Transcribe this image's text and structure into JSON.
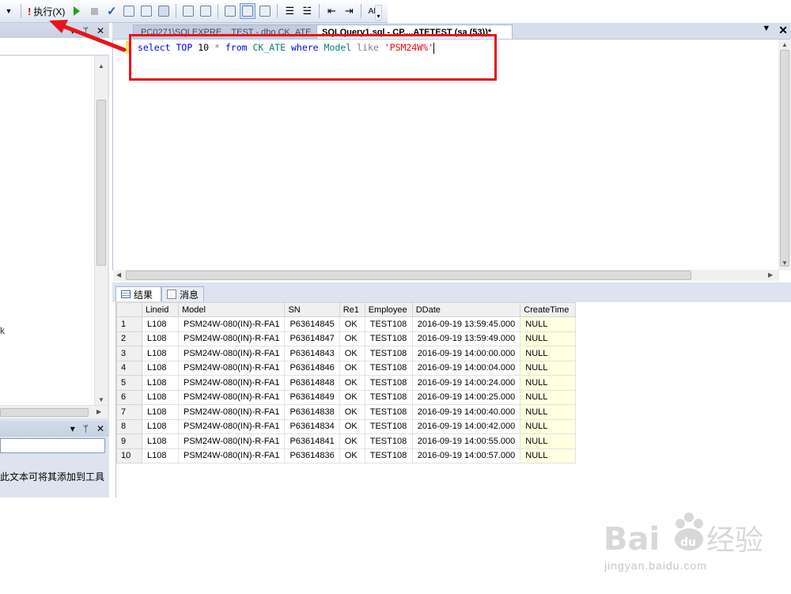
{
  "toolbar": {
    "execute_label": "执行(X)",
    "icons": [
      "dropdown-arrow-icon",
      "execute-icon",
      "debug-play-icon",
      "stop-icon",
      "parse-check-icon",
      "query-designer-icon",
      "plan-icon",
      "results-to-grid-icon",
      "results-to-text-icon",
      "results-to-file-icon",
      "comment-icon",
      "uncomment-icon",
      "decrease-indent-icon",
      "increase-indent-icon",
      "specify-values-icon"
    ]
  },
  "left_panel": {
    "header_pin": "ᛘ",
    "header_close": "✕",
    "tree_partial_text": "k",
    "toolbox_text": "此文本可将其添加到工具"
  },
  "editor_tabs": [
    {
      "label": ".PC0271\\SQLEXPRE....TEST - dbo.CK_ATE",
      "active": false
    },
    {
      "label": "SQLQuery1.sql - CP....ATETEST (sa (53))*",
      "active": true
    }
  ],
  "editor": {
    "tokens": [
      {
        "t": "select",
        "c": "kw"
      },
      {
        "t": " ",
        "c": ""
      },
      {
        "t": "TOP",
        "c": "kw"
      },
      {
        "t": " 10 ",
        "c": ""
      },
      {
        "t": "*",
        "c": "op"
      },
      {
        "t": " ",
        "c": ""
      },
      {
        "t": "from",
        "c": "kw"
      },
      {
        "t": " ",
        "c": ""
      },
      {
        "t": "CK_ATE",
        "c": "id"
      },
      {
        "t": " ",
        "c": ""
      },
      {
        "t": "where",
        "c": "kw"
      },
      {
        "t": " ",
        "c": ""
      },
      {
        "t": "Model",
        "c": "id"
      },
      {
        "t": " ",
        "c": ""
      },
      {
        "t": "like",
        "c": "op"
      },
      {
        "t": " ",
        "c": ""
      },
      {
        "t": "'PSM24W%'",
        "c": "str"
      }
    ]
  },
  "results_tabs": {
    "results": "结果",
    "messages": "消息"
  },
  "grid": {
    "columns": [
      "Lineid",
      "Model",
      "SN",
      "Re1",
      "Employee",
      "DDate",
      "CreateTime"
    ],
    "rows": [
      [
        "1",
        "L108",
        "PSM24W-080(IN)-R-FA1",
        "P63614845",
        "OK",
        "TEST108",
        "2016-09-19 13:59:45.000",
        "NULL"
      ],
      [
        "2",
        "L108",
        "PSM24W-080(IN)-R-FA1",
        "P63614847",
        "OK",
        "TEST108",
        "2016-09-19 13:59:49.000",
        "NULL"
      ],
      [
        "3",
        "L108",
        "PSM24W-080(IN)-R-FA1",
        "P63614843",
        "OK",
        "TEST108",
        "2016-09-19 14:00:00.000",
        "NULL"
      ],
      [
        "4",
        "L108",
        "PSM24W-080(IN)-R-FA1",
        "P63614846",
        "OK",
        "TEST108",
        "2016-09-19 14:00:04.000",
        "NULL"
      ],
      [
        "5",
        "L108",
        "PSM24W-080(IN)-R-FA1",
        "P63614848",
        "OK",
        "TEST108",
        "2016-09-19 14:00:24.000",
        "NULL"
      ],
      [
        "6",
        "L108",
        "PSM24W-080(IN)-R-FA1",
        "P63614849",
        "OK",
        "TEST108",
        "2016-09-19 14:00:25.000",
        "NULL"
      ],
      [
        "7",
        "L108",
        "PSM24W-080(IN)-R-FA1",
        "P63614838",
        "OK",
        "TEST108",
        "2016-09-19 14:00:40.000",
        "NULL"
      ],
      [
        "8",
        "L108",
        "PSM24W-080(IN)-R-FA1",
        "P63614834",
        "OK",
        "TEST108",
        "2016-09-19 14:00:42.000",
        "NULL"
      ],
      [
        "9",
        "L108",
        "PSM24W-080(IN)-R-FA1",
        "P63614841",
        "OK",
        "TEST108",
        "2016-09-19 14:00:55.000",
        "NULL"
      ],
      [
        "10",
        "L108",
        "PSM24W-080(IN)-R-FA1",
        "P63614836",
        "OK",
        "TEST108",
        "2016-09-19 14:00:57.000",
        "NULL"
      ]
    ]
  },
  "watermark": {
    "brand": "Bai du 经验",
    "url": "jingyan.baidu.com"
  },
  "colors": {
    "annotation": "#e8141c",
    "keyword": "#0000ff",
    "identifier": "#008080",
    "string": "#ff0000",
    "null_bg": "#ffffe1"
  }
}
